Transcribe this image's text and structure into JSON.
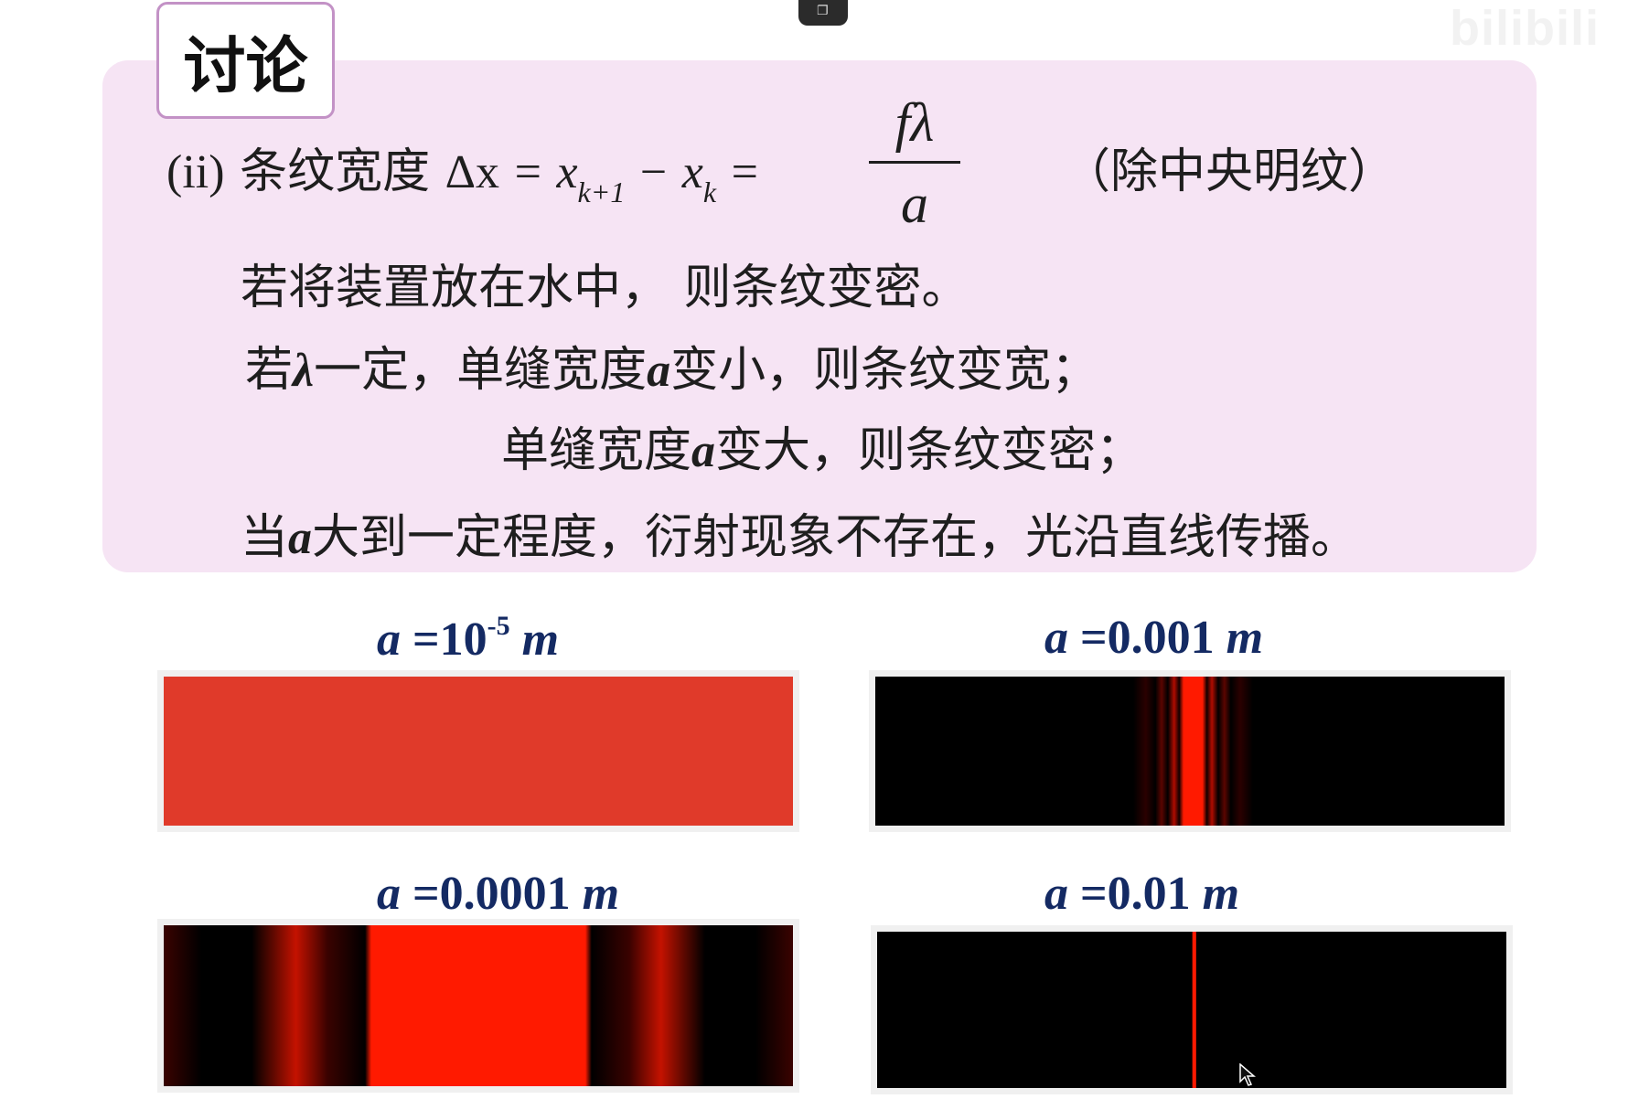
{
  "heading": "讨论",
  "formula": {
    "label": "(ii)",
    "text": "条纹宽度",
    "delta_x": "Δx",
    "eq": "=",
    "x1": "x",
    "sub1": "k+1",
    "minus": "−",
    "x2": "x",
    "sub2": "k",
    "eq2": "=",
    "numerator": "fλ",
    "denominator": "a",
    "note": "（除中央明纹）"
  },
  "lines": {
    "water": "若将装置放在水中，  则条纹变密。",
    "l2_prefix": "若",
    "l2_lambda": "λ",
    "l2_mid": "一定，单缝宽度",
    "l2_a": "a",
    "l2_end": "变小，则条纹变宽；",
    "l3_prefix": "单缝宽度",
    "l3_a": "a",
    "l3_end": "变大，则条纹变密；",
    "l4_prefix": "当",
    "l4_a": "a",
    "l4_end": "大到一定程度，衍射现象不存在，光沿直线传播。"
  },
  "patterns": [
    {
      "a_sym": "a",
      "eq": " =",
      "value": "10",
      "exp": "-5",
      "unit": "m",
      "kind": "uniform"
    },
    {
      "a_sym": "a",
      "eq": " =",
      "value": "0.001",
      "exp": "",
      "unit": "m",
      "kind": "narrow"
    },
    {
      "a_sym": "a",
      "eq": " =",
      "value": "0.0001",
      "exp": "",
      "unit": "m",
      "kind": "wide"
    },
    {
      "a_sym": "a",
      "eq": " =",
      "value": "0.01",
      "exp": "",
      "unit": "m",
      "kind": "line"
    }
  ],
  "watermark": "bilibili",
  "colors": {
    "panel": "#f6e4f4",
    "label": "#142a63",
    "fringe": "#ff1a00",
    "uniform": "#e03a2a"
  }
}
